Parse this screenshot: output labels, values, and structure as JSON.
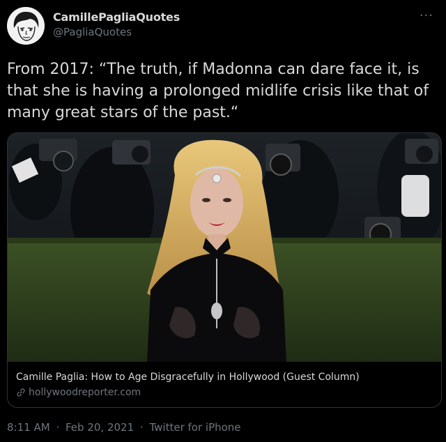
{
  "author": {
    "display_name": "CamillePagliaQuotes",
    "handle": "@PagliaQuotes",
    "avatar_icon": "sketch-portrait-avatar"
  },
  "more_icon": "ellipsis-icon",
  "tweet": {
    "text": "From 2017: “The truth, if Madonna can dare face it, is that she is having a prolonged midlife crisis like that of many great stars of the past.“"
  },
  "link_card": {
    "title": "Camille Paglia: How to Age Disgracefully in Hollywood (Guest Column)",
    "domain": "hollywoodreporter.com",
    "link_icon": "link-icon"
  },
  "meta": {
    "time": "8:11 AM",
    "date": "Feb 20, 2021",
    "source": "Twitter for iPhone",
    "separator": "·"
  },
  "colors": {
    "background": "#000000",
    "text": "#d9d9d9",
    "secondary": "#6e767d",
    "border": "#2f3336"
  }
}
